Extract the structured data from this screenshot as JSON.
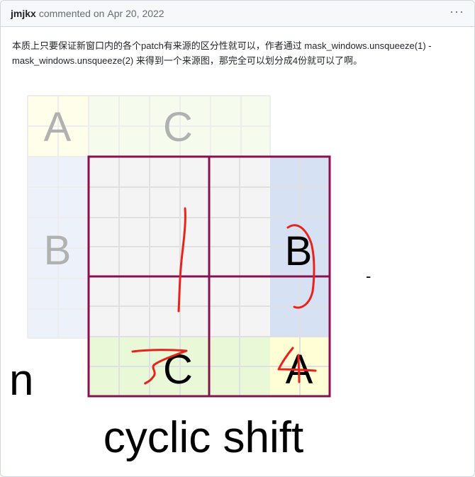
{
  "comment": {
    "author": "jmjkx",
    "action": "commented on",
    "date": "Apr 20, 2022",
    "menu_icon": "kebab-horizontal-icon",
    "body": "本质上只要保证新窗口内的各个patch有来源的区分性就可以，作者通过 mask_windows.unsqueeze(1) - mask_windows.unsqueeze(2) 来得到一个来源图，那完全可以划分成4份就可以了啊。"
  },
  "figure": {
    "faded_labels": {
      "a": "A",
      "c": "C",
      "b": "B"
    },
    "shifted_labels": {
      "b": "B",
      "c": "C",
      "a": "A"
    },
    "left_edge_char": "n",
    "dash_char": "-",
    "caption": "cyclic shift",
    "colors": {
      "window_border": "#8b0f50",
      "gray_region": "#f4f4f4",
      "blue_region": "#d6e2f4",
      "green_region": "#e9f9d8",
      "yellow_region": "#fffed4",
      "annotation_red": "#e8231d"
    }
  }
}
